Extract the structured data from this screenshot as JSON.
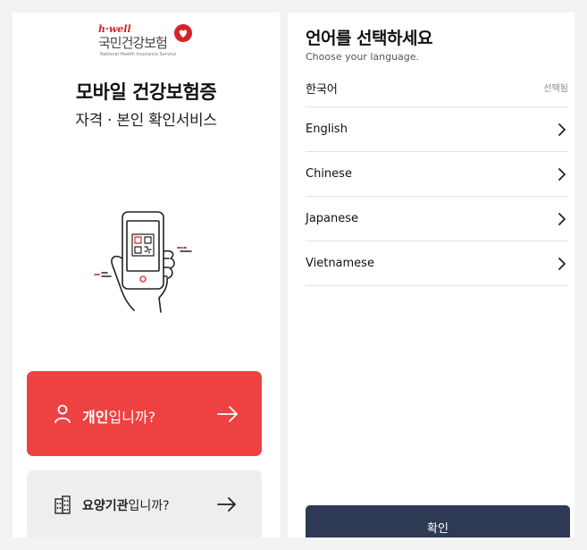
{
  "colors": {
    "accent_red": "#ee4141",
    "confirm_navy": "#2e3a54",
    "gray_button": "#eeeeee"
  },
  "logo": {
    "brand": "h·well",
    "name": "국민건강보험",
    "sub": "National Health Insurance Service"
  },
  "left": {
    "title": "모바일 건강보험증",
    "subtitle": "자격 · 본인 확인서비스",
    "personal_button": {
      "bold": "개인",
      "rest": "입니까?",
      "icon": "person-icon"
    },
    "facility_button": {
      "bold": "요양기관",
      "rest": "입니까?",
      "icon": "building-icon"
    }
  },
  "right": {
    "title": "언어를 선택하세요",
    "subtitle": "Choose your language.",
    "languages": [
      {
        "name": "한국어",
        "status": "선택됨"
      },
      {
        "name": "English"
      },
      {
        "name": "Chinese"
      },
      {
        "name": "Japanese"
      },
      {
        "name": "Vietnamese"
      }
    ],
    "confirm_label": "확인"
  }
}
